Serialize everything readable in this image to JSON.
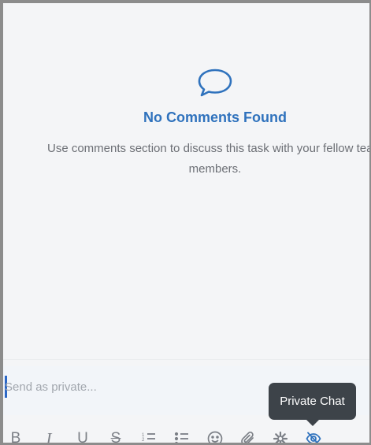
{
  "empty_state": {
    "icon": "speech-bubble-icon",
    "title": "No Comments Found",
    "description": "Use comments section to discuss this task with your fellow team members."
  },
  "composer": {
    "placeholder": "Send as private...",
    "value": ""
  },
  "toolbar": {
    "bold_label": "B",
    "italic_label": "I",
    "underline_label": "U",
    "strike_label": "S",
    "icons": [
      "bold-icon",
      "italic-icon",
      "underline-icon",
      "strikethrough-icon",
      "numbered-list-icon",
      "bulleted-list-icon",
      "emoji-icon",
      "attachment-icon",
      "integration-icon",
      "private-chat-icon"
    ]
  },
  "tooltip": {
    "text": "Private Chat"
  },
  "colors": {
    "accent": "#2f72bd",
    "tooltip_bg": "#3d4349",
    "background": "#f4f5f7"
  }
}
